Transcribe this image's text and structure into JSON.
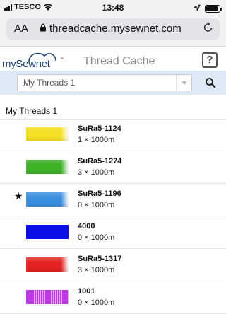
{
  "status_bar": {
    "carrier": "TESCO",
    "time": "13:48"
  },
  "browser": {
    "text_size_label": "AA",
    "url": "threadcache.mysewnet.com"
  },
  "app": {
    "logo": "mySewnet",
    "title": "Thread Cache",
    "help_label": "?"
  },
  "selector": {
    "selected": "My Threads 1"
  },
  "list": {
    "title": "My Threads 1",
    "threads": [
      {
        "name": "SuRa5-1124",
        "qty": "1 × 1000m",
        "starred": false,
        "color": "#f4e024",
        "style": "gradient"
      },
      {
        "name": "SuRa5-1274",
        "qty": "3 × 1000m",
        "starred": false,
        "color": "#3db227",
        "style": "gradient"
      },
      {
        "name": "SuRa5-1196",
        "qty": "0 × 1000m",
        "starred": true,
        "star": "★",
        "color": "#3c8fe0",
        "style": "gradient"
      },
      {
        "name": "4000",
        "qty": "0 × 1000m",
        "starred": false,
        "color": "#0a0fe8",
        "style": "flat"
      },
      {
        "name": "SuRa5-1317",
        "qty": "3 × 1000m",
        "starred": false,
        "color": "#e42222",
        "style": "gradient"
      },
      {
        "name": "1001",
        "qty": "0 × 1000m",
        "starred": false,
        "color": "#c237e6",
        "style": "striped"
      }
    ]
  }
}
